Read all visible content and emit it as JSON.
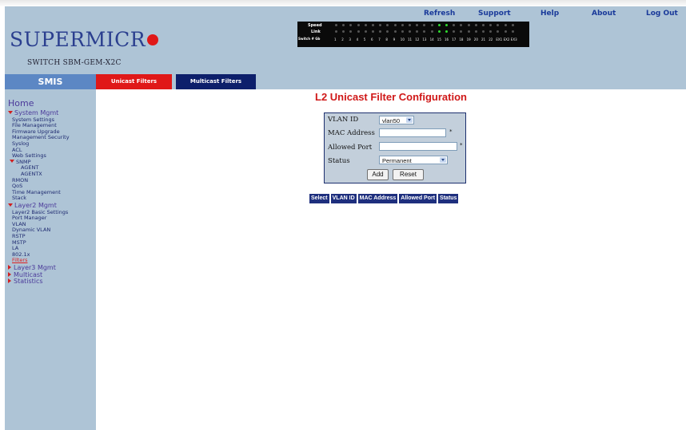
{
  "header": {
    "brand": "SUPERMICR",
    "model": "SWITCH SBM-GEM-X2C",
    "nav": [
      "Refresh",
      "Support",
      "Help",
      "About",
      "Log Out"
    ]
  },
  "led_panel": {
    "speed_label": "Speed",
    "link_label": "Link",
    "switch_label": "Switch # Gb",
    "port_labels": [
      "1",
      "2",
      "3",
      "4",
      "5",
      "6",
      "7",
      "8",
      "9",
      "10",
      "11",
      "12",
      "13",
      "14",
      "15",
      "16",
      "17",
      "18",
      "19",
      "20",
      "21",
      "22",
      "EX1",
      "EX2",
      "EX3"
    ],
    "active_ports": [
      15,
      16
    ],
    "active_color": "#2edb2e"
  },
  "tabs": {
    "smis": "SMIS",
    "unicast": "Unicast Filters",
    "multicast": "Multicast Filters",
    "unicast_color": "#e01818",
    "multicast_color": "#0d1f6b"
  },
  "sidebar": {
    "home": "Home",
    "items": [
      {
        "label": "System Mgmt",
        "level": 1,
        "arrow": "down"
      },
      {
        "label": "System Settings",
        "level": 2
      },
      {
        "label": "File Management",
        "level": 2
      },
      {
        "label": "Firmware Upgrade",
        "level": 2
      },
      {
        "label": "Management Security",
        "level": 2
      },
      {
        "label": "Syslog",
        "level": 2
      },
      {
        "label": "ACL",
        "level": 2
      },
      {
        "label": "Web Settings",
        "level": 2
      },
      {
        "label": "SNMP",
        "level": 2,
        "arrow": "down"
      },
      {
        "label": "AGENT",
        "level": 3
      },
      {
        "label": "AGENTX",
        "level": 3
      },
      {
        "label": "RMON",
        "level": 2
      },
      {
        "label": "QoS",
        "level": 2
      },
      {
        "label": "Time Management",
        "level": 2
      },
      {
        "label": "Stack",
        "level": 2
      },
      {
        "label": "Layer2 Mgmt",
        "level": 1,
        "arrow": "down"
      },
      {
        "label": "Layer2 Basic Settings",
        "level": 2
      },
      {
        "label": "Port Manager",
        "level": 2
      },
      {
        "label": "VLAN",
        "level": 2
      },
      {
        "label": "Dynamic VLAN",
        "level": 2
      },
      {
        "label": "RSTP",
        "level": 2
      },
      {
        "label": "MSTP",
        "level": 2
      },
      {
        "label": "LA",
        "level": 2
      },
      {
        "label": "802.1x",
        "level": 2
      },
      {
        "label": "Filters",
        "level": 2,
        "active": true
      },
      {
        "label": "Layer3 Mgmt",
        "level": 1,
        "arrow": "right"
      },
      {
        "label": "Multicast",
        "level": 1,
        "arrow": "right"
      },
      {
        "label": "Statistics",
        "level": 1,
        "arrow": "right"
      }
    ]
  },
  "main": {
    "title": "L2 Unicast Filter Configuration",
    "form": {
      "vlan_label": "VLAN ID",
      "vlan_value": "vlan50",
      "mac_label": "MAC Address",
      "mac_value": "",
      "port_label": "Allowed Port",
      "port_value": "",
      "status_label": "Status",
      "status_value": "Permanent",
      "required_mark": "*",
      "add": "Add",
      "reset": "Reset"
    },
    "table": {
      "columns": [
        "Select",
        "VLAN ID",
        "MAC Address",
        "Allowed Port",
        "Status"
      ]
    }
  }
}
